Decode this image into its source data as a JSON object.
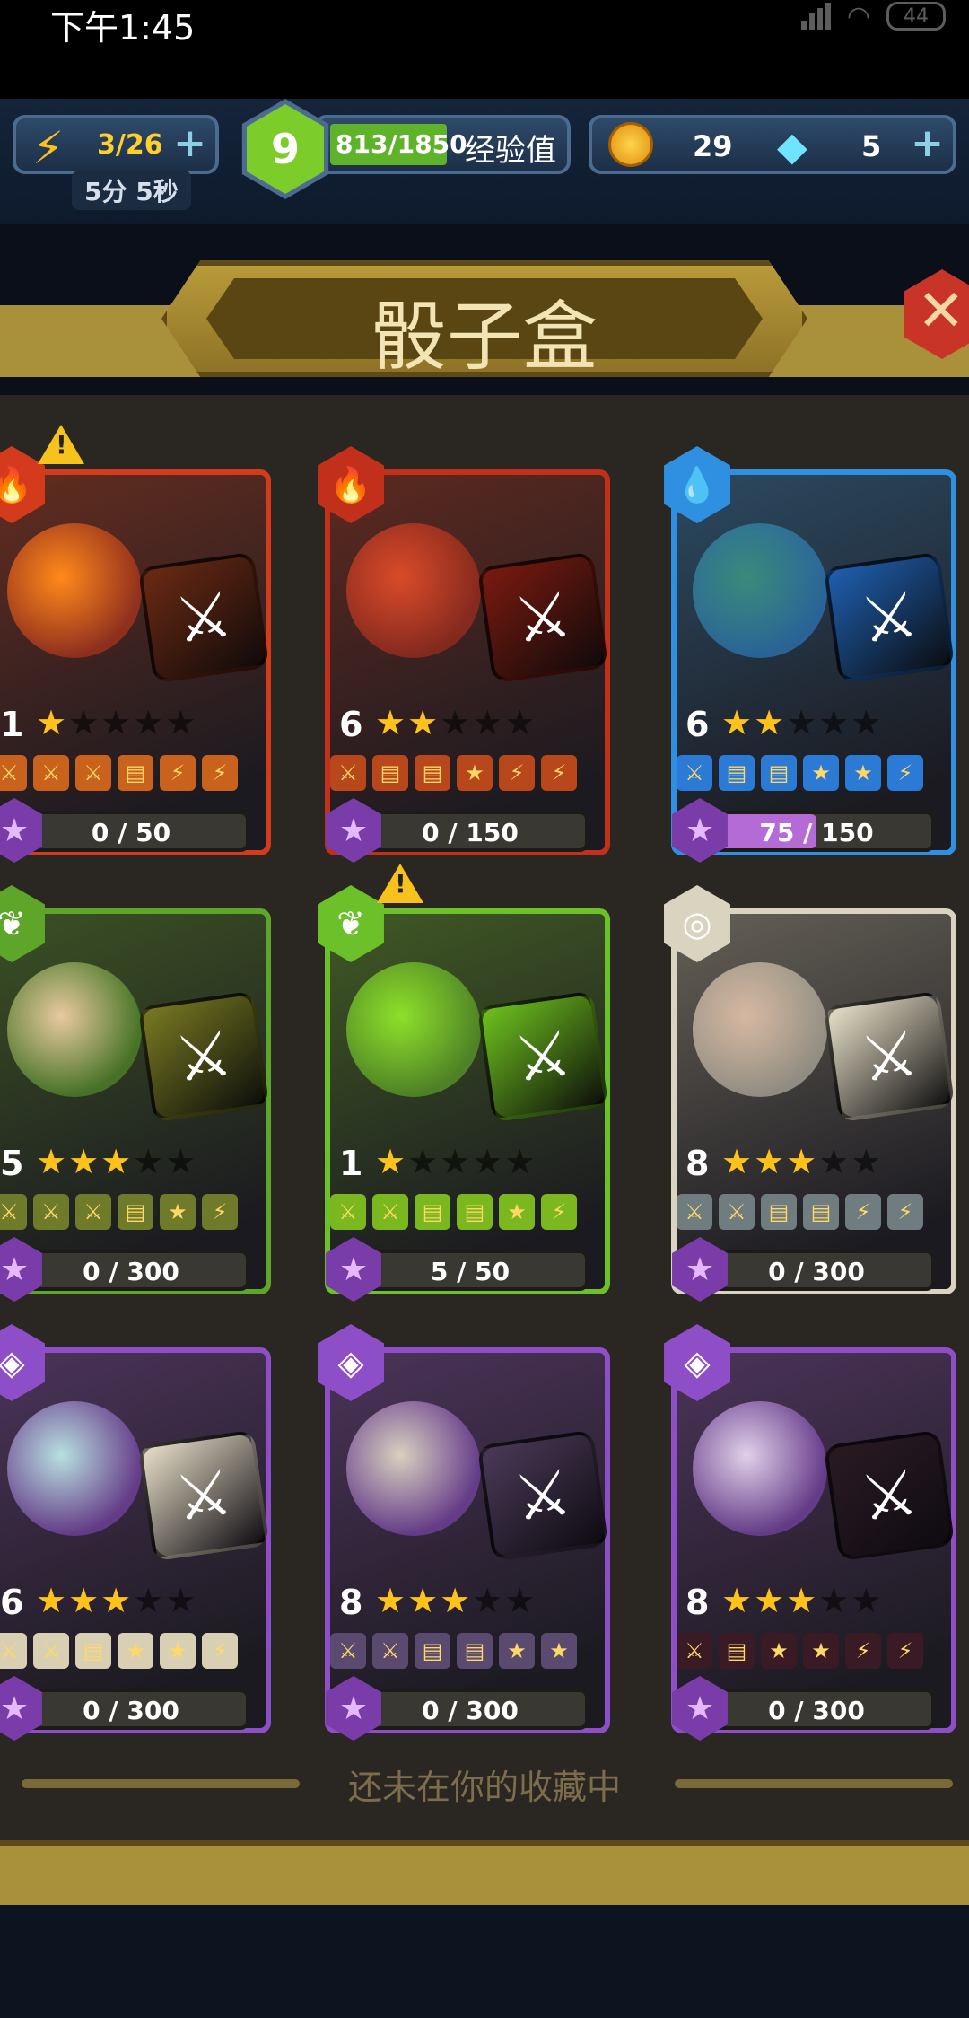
{
  "status_bar": {
    "time": "下午1:45",
    "battery": "44"
  },
  "top_bar": {
    "energy": "3/26",
    "energy_timer": "5分 5秒",
    "level": "9",
    "xp": "813/1850",
    "xp_label": "经验值",
    "coins": "29",
    "gems": "5"
  },
  "title": "骰子盒",
  "cards": [
    {
      "level": "1",
      "stars": 1,
      "element": "fire",
      "color": "#d43a1c",
      "progress": "0 / 50",
      "progress_fraction": 0,
      "warning": true,
      "die_color": "#6b2a14",
      "face_color": "#ff8a1a",
      "faces": [
        "⚔",
        "⚔",
        "⚔",
        "▤",
        "⚡",
        "⚡"
      ],
      "face_bg": "#c8621c"
    },
    {
      "level": "6",
      "stars": 2,
      "element": "fire",
      "color": "#c2301c",
      "progress": "0 / 150",
      "progress_fraction": 0,
      "warning": false,
      "die_color": "#7a1a10",
      "face_color": "#d94b2a",
      "faces": [
        "⚔",
        "▤",
        "▤",
        "★",
        "⚡",
        "⚡"
      ],
      "face_bg": "#b8481c"
    },
    {
      "level": "6",
      "stars": 2,
      "element": "water",
      "color": "#2f8fe0",
      "progress": "75 / 150",
      "progress_fraction": 0.5,
      "warning": false,
      "die_color": "#1f5fb0",
      "face_color": "#3a8a7a",
      "faces": [
        "⚔",
        "▤",
        "▤",
        "★",
        "★",
        "⚡"
      ],
      "face_bg": "#2a7ad6"
    },
    {
      "level": "5",
      "stars": 3,
      "element": "nature",
      "color": "#5ea62a",
      "progress": "0 / 300",
      "progress_fraction": 0,
      "warning": false,
      "die_color": "#7a7a22",
      "face_color": "#e8c9a0",
      "faces": [
        "⚔",
        "⚔",
        "⚔",
        "▤",
        "★",
        "⚡"
      ],
      "face_bg": "#6f7a2a"
    },
    {
      "level": "1",
      "stars": 1,
      "element": "nature",
      "color": "#6cc02a",
      "progress": "5 / 50",
      "progress_fraction": 0.1,
      "warning": true,
      "die_color": "#6fc21f",
      "face_color": "#8de02a",
      "faces": [
        "⚔",
        "⚔",
        "▤",
        "▤",
        "★",
        "⚡"
      ],
      "face_bg": "#7bb81f"
    },
    {
      "level": "8",
      "stars": 3,
      "element": "air",
      "color": "#d9d3c0",
      "progress": "0 / 300",
      "progress_fraction": 0,
      "warning": false,
      "die_color": "#e8e0c8",
      "face_color": "#d6b8a0",
      "faces": [
        "⚔",
        "⚔",
        "▤",
        "▤",
        "⚡",
        "⚡"
      ],
      "face_bg": "#6f7d80"
    },
    {
      "level": "6",
      "stars": 3,
      "element": "arcane",
      "color": "#8e4ec8",
      "progress": "0 / 300",
      "progress_fraction": 0,
      "warning": false,
      "die_color": "#e8e0c8",
      "face_color": "#b8e0e0",
      "faces": [
        "⚔",
        "⚔",
        "▤",
        "★",
        "★",
        "⚡"
      ],
      "face_bg": "#d9d0b4"
    },
    {
      "level": "8",
      "stars": 3,
      "element": "arcane",
      "color": "#8e4ec8",
      "progress": "0 / 300",
      "progress_fraction": 0,
      "warning": false,
      "die_color": "#4a3a58",
      "face_color": "#d8d0c0",
      "faces": [
        "⚔",
        "⚔",
        "▤",
        "▤",
        "★",
        "★"
      ],
      "face_bg": "#5a4a70"
    },
    {
      "level": "8",
      "stars": 3,
      "element": "arcane",
      "color": "#8e4ec8",
      "progress": "0 / 300",
      "progress_fraction": 0,
      "warning": false,
      "die_color": "#2a1a22",
      "face_color": "#e0d0e8",
      "faces": [
        "⚔",
        "▤",
        "★",
        "★",
        "⚡",
        "⚡"
      ],
      "face_bg": "#3a1a24"
    }
  ],
  "collection_note": "还未在你的收藏中"
}
